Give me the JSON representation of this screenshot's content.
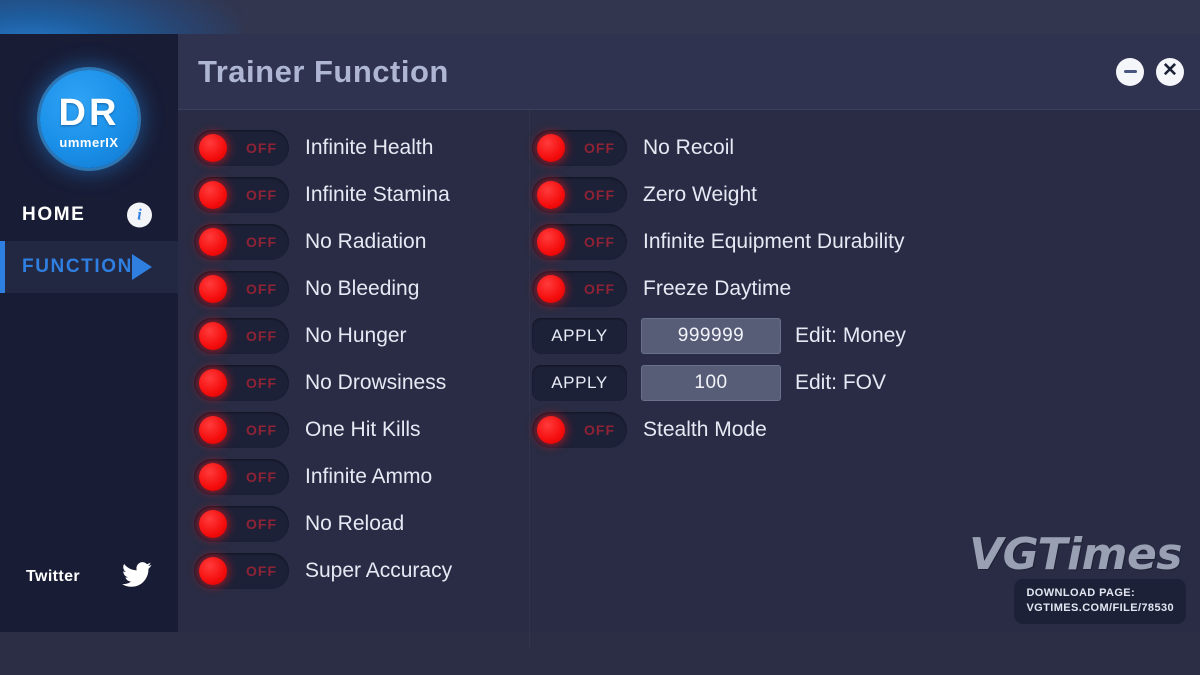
{
  "window": {
    "title": "Trainer Function",
    "minimize_label": "–",
    "close_label": "✕"
  },
  "sidebar": {
    "logo": {
      "main_text": "DR",
      "sub_text": "ummerIX"
    },
    "items": [
      {
        "label": "HOME",
        "icon": "info-icon",
        "active": false
      },
      {
        "label": "FUNCTION",
        "icon": "play-triangle-icon",
        "active": true
      }
    ],
    "social": {
      "label": "Twitter",
      "icon": "twitter-bird-icon"
    }
  },
  "content": {
    "left_column": [
      {
        "type": "toggle",
        "state": "OFF",
        "label": "Infinite Health"
      },
      {
        "type": "toggle",
        "state": "OFF",
        "label": "Infinite Stamina"
      },
      {
        "type": "toggle",
        "state": "OFF",
        "label": "No Radiation"
      },
      {
        "type": "toggle",
        "state": "OFF",
        "label": "No Bleeding"
      },
      {
        "type": "toggle",
        "state": "OFF",
        "label": "No Hunger"
      },
      {
        "type": "toggle",
        "state": "OFF",
        "label": "No Drowsiness"
      },
      {
        "type": "toggle",
        "state": "OFF",
        "label": "One Hit Kills"
      },
      {
        "type": "toggle",
        "state": "OFF",
        "label": "Infinite Ammo"
      },
      {
        "type": "toggle",
        "state": "OFF",
        "label": "No Reload"
      },
      {
        "type": "toggle",
        "state": "OFF",
        "label": "Super Accuracy"
      }
    ],
    "right_column": [
      {
        "type": "toggle",
        "state": "OFF",
        "label": "No Recoil"
      },
      {
        "type": "toggle",
        "state": "OFF",
        "label": "Zero Weight"
      },
      {
        "type": "toggle",
        "state": "OFF",
        "label": "Infinite Equipment Durability"
      },
      {
        "type": "toggle",
        "state": "OFF",
        "label": "Freeze Daytime"
      },
      {
        "type": "apply",
        "button": "APPLY",
        "value": "999999",
        "label": "Edit: Money"
      },
      {
        "type": "apply",
        "button": "APPLY",
        "value": "100",
        "label": "Edit: FOV"
      },
      {
        "type": "toggle",
        "state": "OFF",
        "label": "Stealth Mode"
      }
    ]
  },
  "watermark": {
    "brand": "VGTimes",
    "line1": "DOWNLOAD PAGE:",
    "line2": "VGTIMES.COM/FILE/78530"
  },
  "colors": {
    "accent_blue": "#2f7fe0",
    "toggle_red": "#f50d0d",
    "off_text": "#8f2234",
    "panel_bg": "#292c44",
    "sidebar_bg": "#181c35",
    "title_text": "#aeb6d4"
  }
}
